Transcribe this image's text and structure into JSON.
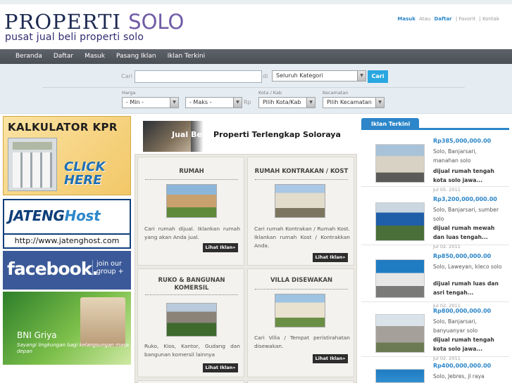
{
  "header": {
    "logo_main": "PROPERTI",
    "logo_accent": "SOLO",
    "tagline": "pusat jual beli properti solo",
    "links": {
      "masuk": "Masuk",
      "atau": "Atau",
      "daftar": "Daftar",
      "favorit": "| Favorit",
      "kontak": "| Kontak"
    }
  },
  "nav": {
    "items": [
      "Beranda",
      "Daftar",
      "Masuk",
      "Pasang Iklan",
      "Iklan Terkini"
    ]
  },
  "search": {
    "label": "Cari",
    "input_value": "",
    "di_label": "di",
    "category": "Seluruh Kategori",
    "button": "Cari",
    "harga_label": "Harga",
    "min": "- Min -",
    "max": "- Maks -",
    "rp_label": "Rp",
    "kota_label": "Kota / Kab",
    "kota": "Pilih Kota/Kab",
    "kecamatan_label": "Kecamatan",
    "kecamatan": "Pilih Kecamatan"
  },
  "banners": {
    "kpr_title": "KALKULATOR KPR",
    "kpr_click": "CLICK HERE",
    "jateng_word_a": "JATENG",
    "jateng_word_b": "Host",
    "jateng_url": "http://www.jatenghost.com",
    "fb_word": "facebook.",
    "fb_join": "join our group +",
    "bni_word_a": "BNI",
    "bni_word_b": " Griya",
    "bni_sub": "Sayangi lingkungan bagi kelangsungan masa depan"
  },
  "center": {
    "banner_text_a": "Jual Beli",
    "banner_text_b": "Properti Terlengkap Soloraya",
    "cards": [
      {
        "title": "RUMAH",
        "desc": "Cari rumah dijual. Iklankan rumah yang akan Anda jual.",
        "button": "Lihat Iklan»"
      },
      {
        "title": "RUMAH KONTRAKAN / KOST",
        "desc": "Cari rumah Kontrakan / Rumah Kost. Iklankan rumah Kost / Kontrakkan Anda.",
        "button": "Lihat Iklan»"
      },
      {
        "title": "RUKO & BANGUNAN KOMERSIL",
        "desc": "Ruko, Kios, Kantor, Gudang dan bangunan komersil lainnya",
        "button": "Lihat Iklan»"
      },
      {
        "title": "VILLA DISEWAKAN",
        "desc": "Cari Villa / Tempat peristirahatan disewakan.",
        "button": "Lihat Iklan»"
      }
    ]
  },
  "right": {
    "tab": "Iklan Terkini",
    "ads": [
      {
        "price": "Rp385,000,000.00",
        "loc": "Solo, Banjarsari, manahan solo",
        "title": "dijual rumah tengah kota solo jawa...",
        "date": "Jul 05. 2011"
      },
      {
        "price": "Rp3,200,000,000.00",
        "loc": "Solo, Banjarsari, sumber solo",
        "title": "dijual rumah mewah dan luas tengah...",
        "date": "Jul 02. 2011"
      },
      {
        "price": "Rp850,000,000.00",
        "loc": "Solo, Laweyan, kleco solo",
        "title": "dijual rumah luas dan asri tengah...",
        "date": "Jul 02. 2011"
      },
      {
        "price": "Rp800,000,000.00",
        "loc": "Solo, Banjarsari, banyuanyar solo",
        "title": "dijual rumah tengah kota solo jawa...",
        "date": "Jul 02. 2011"
      },
      {
        "price": "Rp400,000,000.00",
        "loc": "Solo, Jebres, jl raya",
        "title": "",
        "date": ""
      }
    ]
  }
}
